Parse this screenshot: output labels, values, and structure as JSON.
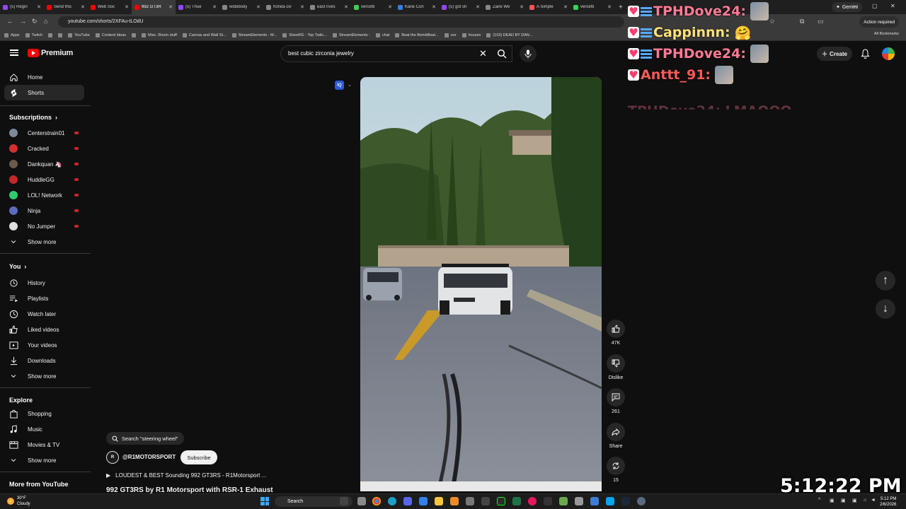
{
  "browser": {
    "tabs": [
      {
        "title": "(5) Regin",
        "color": "#9146ff"
      },
      {
        "title": "Send this",
        "color": "#ff0000"
      },
      {
        "title": "Web Soc",
        "color": "#ff0000"
      },
      {
        "title": "992 GT3R",
        "color": "#ff0000",
        "active": true
      },
      {
        "title": "(5) Thue",
        "color": "#9146ff"
      },
      {
        "title": "widebody",
        "color": "#888888"
      },
      {
        "title": "honda civ",
        "color": "#888888"
      },
      {
        "title": "east rives",
        "color": "#888888"
      },
      {
        "title": "vercetti",
        "color": "#39d353"
      },
      {
        "title": "Kane Con",
        "color": "#2f80ed"
      },
      {
        "title": "(5) got sh",
        "color": "#9146ff"
      },
      {
        "title": "Zaire We",
        "color": "#888888"
      },
      {
        "title": "A Simple",
        "color": "#ff5252"
      },
      {
        "title": "vercetti",
        "color": "#39d353"
      }
    ],
    "gemini_label": "Gemini",
    "url": "youtube.com/shorts/2XFAu-tLOdU",
    "action_required": "Action required",
    "bookmarks": [
      "Apps",
      "Twitch",
      "",
      "",
      "YouTube",
      "Content Ideas",
      "",
      "Misc. Room stuff",
      "Canvas and Wall St...",
      "StreamElements - M...",
      "SheetFE - Top Twitc...",
      "StreamElements -",
      "chat",
      "Beat the BombBeat...",
      "oor",
      "houses",
      "(103) DEAD BY DAN..."
    ],
    "all_bookmarks": "All Bookmarks"
  },
  "youtube": {
    "logo_text": "Premium",
    "search_query": "best cubic zirconia jewelry",
    "create_label": "Create",
    "sidebar": {
      "main": [
        {
          "label": "Home",
          "icon": "home-icon"
        },
        {
          "label": "Shorts",
          "icon": "shorts-icon",
          "active": true
        }
      ],
      "subscriptions_heading": "Subscriptions",
      "subscriptions": [
        {
          "label": "Centerstrain01",
          "color": "#7c8a99"
        },
        {
          "label": "Cracked",
          "color": "#d32f2f"
        },
        {
          "label": "Dankquan 🦄",
          "color": "#6d5a4a"
        },
        {
          "label": "HuddleGG",
          "color": "#c62828"
        },
        {
          "label": "LOL! Network",
          "color": "#2ecc71"
        },
        {
          "label": "Ninja",
          "color": "#5c6bc0"
        },
        {
          "label": "No Jumper",
          "color": "#e0e0e0"
        }
      ],
      "show_more_1": "Show more",
      "you_heading": "You",
      "you": [
        {
          "label": "History",
          "icon": "history-icon"
        },
        {
          "label": "Playlists",
          "icon": "playlists-icon"
        },
        {
          "label": "Watch later",
          "icon": "watch-later-icon"
        },
        {
          "label": "Liked videos",
          "icon": "thumbs-up-icon"
        },
        {
          "label": "Your videos",
          "icon": "your-videos-icon"
        },
        {
          "label": "Downloads",
          "icon": "download-icon"
        }
      ],
      "show_more_2": "Show more",
      "explore_heading": "Explore",
      "explore": [
        {
          "label": "Shopping",
          "icon": "shopping-bag-icon"
        },
        {
          "label": "Music",
          "icon": "music-note-icon"
        },
        {
          "label": "Movies & TV",
          "icon": "movies-icon"
        }
      ],
      "show_more_3": "Show more",
      "more_heading": "More from YouTube"
    },
    "short": {
      "quality_badge": "IQ",
      "likes": "47K",
      "dislike_label": "Dislike",
      "comments": "261",
      "share_label": "Share",
      "remix_count": "15",
      "search_suggestion": "Search \"steering wheel\"",
      "channel_avatar_text": "R",
      "channel": "@R1MOTORSPORT",
      "subscribe_label": "Subscribe",
      "playlist": "LOUDEST & BEST Sounding 992 GT3RS - R1Motorsport ...",
      "title": "992 GT3RS by R1 Motorsport with RSR-1 Exhaust"
    }
  },
  "stream_overlay": {
    "chat": [
      {
        "user": "TPHDove24:",
        "message": "",
        "style": "uname"
      },
      {
        "user": "Cappinnn:",
        "message": "🤗",
        "style": "cap"
      },
      {
        "user": "TPHDove24:",
        "message": "",
        "style": "uname"
      },
      {
        "user": "Anttt_91:",
        "message": "",
        "style": "ant"
      }
    ],
    "fading_line": "TPHDove24: LMAOOO",
    "clock": "5:12:22 PM"
  },
  "taskbar": {
    "weather_temp": "30°F",
    "weather_desc": "Cloudy",
    "search_label": "Search",
    "time": "5:12 PM",
    "date": "2/6/2026"
  }
}
